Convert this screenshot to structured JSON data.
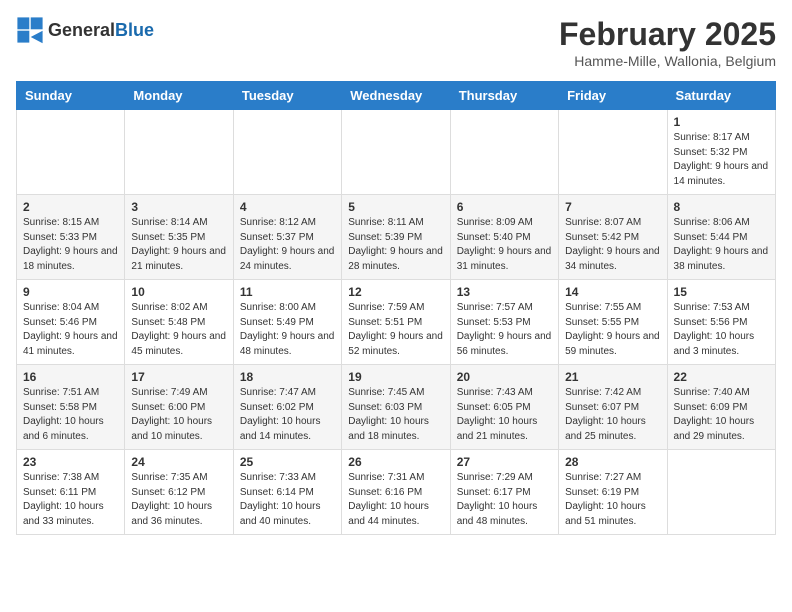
{
  "logo": {
    "text_general": "General",
    "text_blue": "Blue"
  },
  "title": "February 2025",
  "subtitle": "Hamme-Mille, Wallonia, Belgium",
  "weekdays": [
    "Sunday",
    "Monday",
    "Tuesday",
    "Wednesday",
    "Thursday",
    "Friday",
    "Saturday"
  ],
  "weeks": [
    [
      {
        "day": "",
        "info": ""
      },
      {
        "day": "",
        "info": ""
      },
      {
        "day": "",
        "info": ""
      },
      {
        "day": "",
        "info": ""
      },
      {
        "day": "",
        "info": ""
      },
      {
        "day": "",
        "info": ""
      },
      {
        "day": "1",
        "info": "Sunrise: 8:17 AM\nSunset: 5:32 PM\nDaylight: 9 hours and 14 minutes."
      }
    ],
    [
      {
        "day": "2",
        "info": "Sunrise: 8:15 AM\nSunset: 5:33 PM\nDaylight: 9 hours and 18 minutes."
      },
      {
        "day": "3",
        "info": "Sunrise: 8:14 AM\nSunset: 5:35 PM\nDaylight: 9 hours and 21 minutes."
      },
      {
        "day": "4",
        "info": "Sunrise: 8:12 AM\nSunset: 5:37 PM\nDaylight: 9 hours and 24 minutes."
      },
      {
        "day": "5",
        "info": "Sunrise: 8:11 AM\nSunset: 5:39 PM\nDaylight: 9 hours and 28 minutes."
      },
      {
        "day": "6",
        "info": "Sunrise: 8:09 AM\nSunset: 5:40 PM\nDaylight: 9 hours and 31 minutes."
      },
      {
        "day": "7",
        "info": "Sunrise: 8:07 AM\nSunset: 5:42 PM\nDaylight: 9 hours and 34 minutes."
      },
      {
        "day": "8",
        "info": "Sunrise: 8:06 AM\nSunset: 5:44 PM\nDaylight: 9 hours and 38 minutes."
      }
    ],
    [
      {
        "day": "9",
        "info": "Sunrise: 8:04 AM\nSunset: 5:46 PM\nDaylight: 9 hours and 41 minutes."
      },
      {
        "day": "10",
        "info": "Sunrise: 8:02 AM\nSunset: 5:48 PM\nDaylight: 9 hours and 45 minutes."
      },
      {
        "day": "11",
        "info": "Sunrise: 8:00 AM\nSunset: 5:49 PM\nDaylight: 9 hours and 48 minutes."
      },
      {
        "day": "12",
        "info": "Sunrise: 7:59 AM\nSunset: 5:51 PM\nDaylight: 9 hours and 52 minutes."
      },
      {
        "day": "13",
        "info": "Sunrise: 7:57 AM\nSunset: 5:53 PM\nDaylight: 9 hours and 56 minutes."
      },
      {
        "day": "14",
        "info": "Sunrise: 7:55 AM\nSunset: 5:55 PM\nDaylight: 9 hours and 59 minutes."
      },
      {
        "day": "15",
        "info": "Sunrise: 7:53 AM\nSunset: 5:56 PM\nDaylight: 10 hours and 3 minutes."
      }
    ],
    [
      {
        "day": "16",
        "info": "Sunrise: 7:51 AM\nSunset: 5:58 PM\nDaylight: 10 hours and 6 minutes."
      },
      {
        "day": "17",
        "info": "Sunrise: 7:49 AM\nSunset: 6:00 PM\nDaylight: 10 hours and 10 minutes."
      },
      {
        "day": "18",
        "info": "Sunrise: 7:47 AM\nSunset: 6:02 PM\nDaylight: 10 hours and 14 minutes."
      },
      {
        "day": "19",
        "info": "Sunrise: 7:45 AM\nSunset: 6:03 PM\nDaylight: 10 hours and 18 minutes."
      },
      {
        "day": "20",
        "info": "Sunrise: 7:43 AM\nSunset: 6:05 PM\nDaylight: 10 hours and 21 minutes."
      },
      {
        "day": "21",
        "info": "Sunrise: 7:42 AM\nSunset: 6:07 PM\nDaylight: 10 hours and 25 minutes."
      },
      {
        "day": "22",
        "info": "Sunrise: 7:40 AM\nSunset: 6:09 PM\nDaylight: 10 hours and 29 minutes."
      }
    ],
    [
      {
        "day": "23",
        "info": "Sunrise: 7:38 AM\nSunset: 6:11 PM\nDaylight: 10 hours and 33 minutes."
      },
      {
        "day": "24",
        "info": "Sunrise: 7:35 AM\nSunset: 6:12 PM\nDaylight: 10 hours and 36 minutes."
      },
      {
        "day": "25",
        "info": "Sunrise: 7:33 AM\nSunset: 6:14 PM\nDaylight: 10 hours and 40 minutes."
      },
      {
        "day": "26",
        "info": "Sunrise: 7:31 AM\nSunset: 6:16 PM\nDaylight: 10 hours and 44 minutes."
      },
      {
        "day": "27",
        "info": "Sunrise: 7:29 AM\nSunset: 6:17 PM\nDaylight: 10 hours and 48 minutes."
      },
      {
        "day": "28",
        "info": "Sunrise: 7:27 AM\nSunset: 6:19 PM\nDaylight: 10 hours and 51 minutes."
      },
      {
        "day": "",
        "info": ""
      }
    ]
  ]
}
